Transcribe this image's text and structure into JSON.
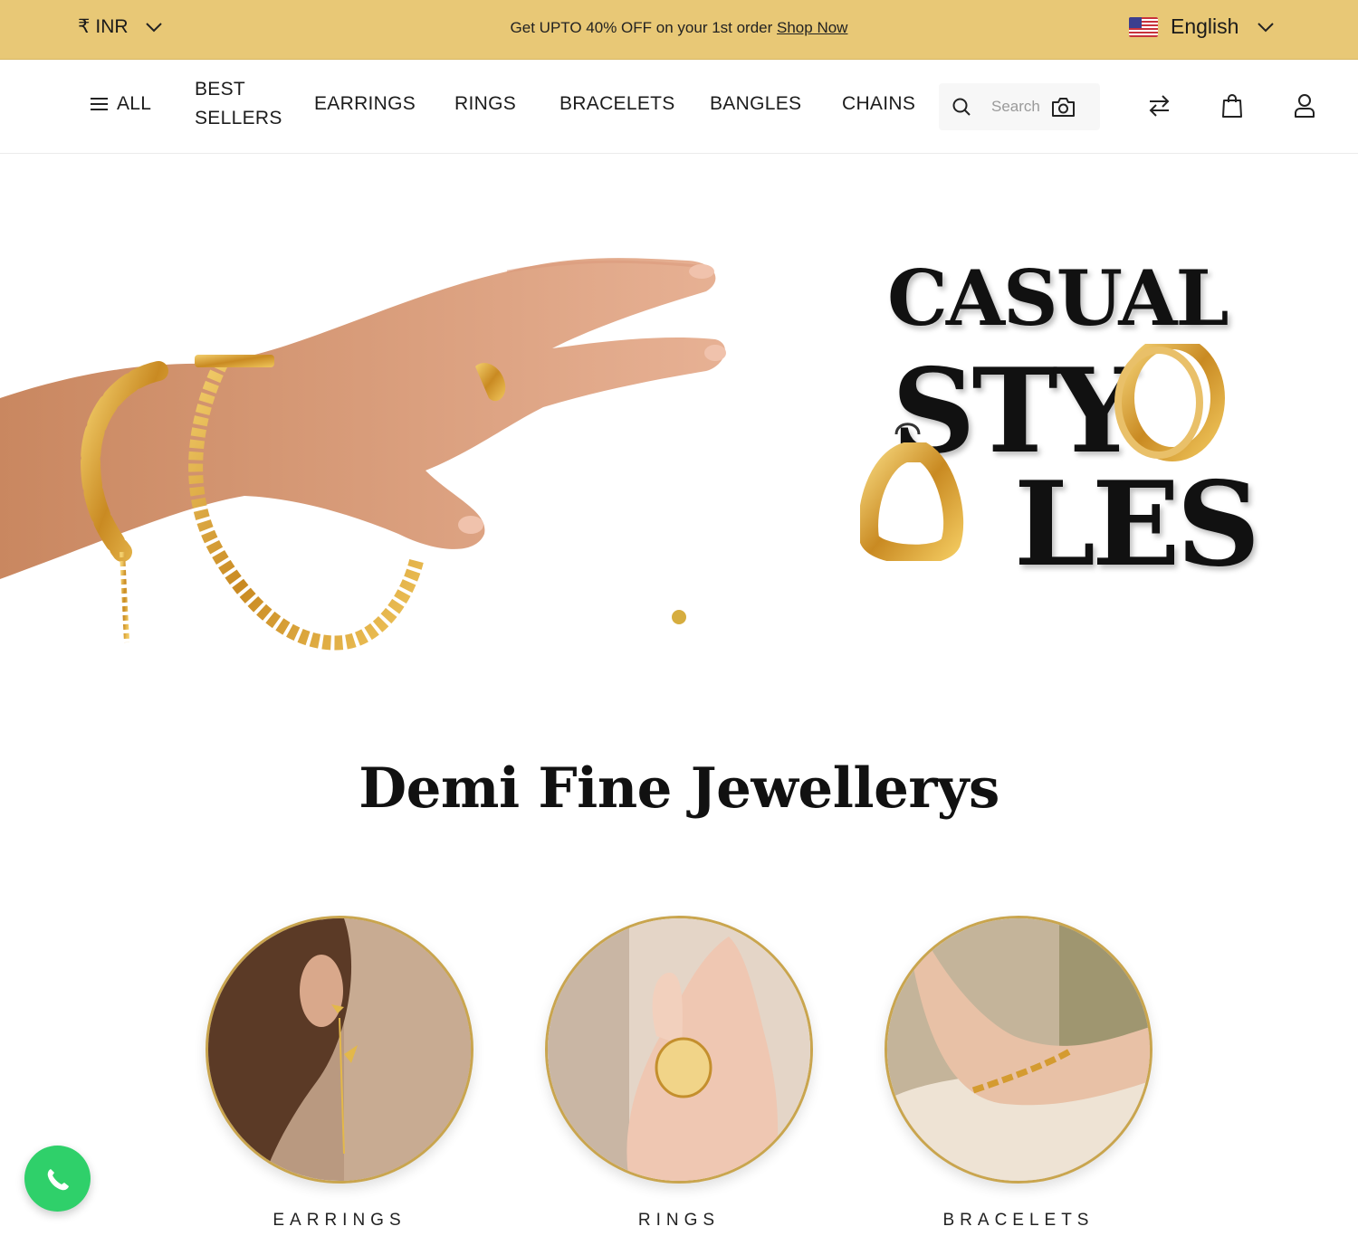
{
  "topbar": {
    "currency_symbol": "₹",
    "currency": "INR",
    "promo_text": "Get UPTO 40% OFF on your 1st order ",
    "promo_link": "Shop Now",
    "language": "English",
    "background": "#e8c876"
  },
  "nav": {
    "all": "ALL",
    "best_line1": "BEST",
    "best_line2": "SELLERS",
    "earrings": "EARRINGS",
    "rings": "RINGS",
    "bracelets": "BRACELETS",
    "bangles": "BANGLES",
    "chains": "CHAINS",
    "search_placeholder": "Search"
  },
  "hero": {
    "title_line1": "CASUAL",
    "title_line2": "STY",
    "title_line3": "LES",
    "active_dot_color": "#d6ad3f"
  },
  "section": {
    "title": "Demi Fine Jewellerys"
  },
  "categories": [
    {
      "label": "EARRINGS"
    },
    {
      "label": "RINGS"
    },
    {
      "label": "BRACELETS"
    }
  ],
  "icons": {
    "menu": "hamburger-icon",
    "search": "search-icon",
    "camera": "camera-icon",
    "compare": "arrows-swap-icon",
    "cart": "shopping-bag-icon",
    "account": "user-icon",
    "whatsapp": "phone-icon"
  }
}
